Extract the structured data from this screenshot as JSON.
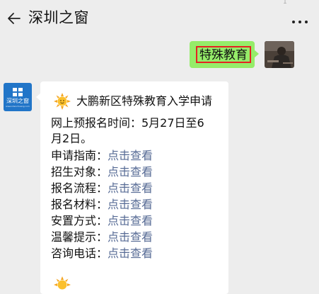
{
  "header": {
    "title": "深圳之窗",
    "top_fragment": "1"
  },
  "sent": {
    "text": "特殊教育"
  },
  "bot": {
    "logo_name": "深圳之窗",
    "logo_sub": "www.shenchuang.com"
  },
  "message": {
    "heading": "大鹏新区特殊教育入学申请",
    "registration_line1": "网上预报名时间：5月27日至6",
    "registration_line2": "月2日。",
    "items": [
      {
        "label": "申请指南：",
        "link": "点击查看"
      },
      {
        "label": "招生对象：",
        "link": "点击查看"
      },
      {
        "label": "报名流程：",
        "link": "点击查看"
      },
      {
        "label": "报名材料：",
        "link": "点击查看"
      },
      {
        "label": "安置方式：",
        "link": "点击查看"
      },
      {
        "label": "温馨提示：",
        "link": "点击查看"
      },
      {
        "label": "咨询电话：",
        "link": "点击查看"
      }
    ]
  },
  "colors": {
    "sent_bubble": "#95ec69",
    "link": "#576b95",
    "highlight_box": "#e52222",
    "logo_bg": "#2175c8"
  },
  "icons": [
    "back-arrow-icon",
    "more-icon",
    "sun-emoji-icon"
  ]
}
